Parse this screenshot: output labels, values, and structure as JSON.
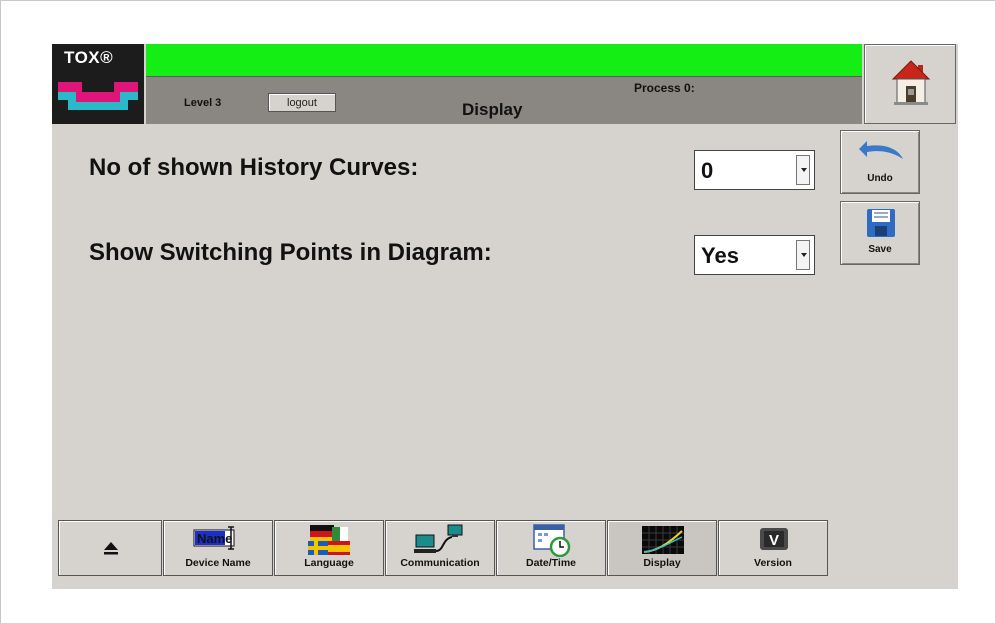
{
  "logo": {
    "brand": "TOX®",
    "text": "TOX"
  },
  "header": {
    "level": "Level 3",
    "logout_label": "logout",
    "process": "Process 0:",
    "title": "Display",
    "status_color": "#15ee15"
  },
  "side_buttons": {
    "home": {
      "icon": "home-icon"
    },
    "undo": {
      "label": "Undo",
      "icon": "undo-arrow-icon"
    },
    "save": {
      "label": "Save",
      "icon": "floppy-disk-icon"
    }
  },
  "settings": [
    {
      "label": "No of shown History Curves:",
      "value": "0"
    },
    {
      "label": "Show Switching Points in Diagram:",
      "value": "Yes"
    }
  ],
  "tabs": [
    {
      "label": "",
      "icon": "eject-triangle-icon"
    },
    {
      "label": "Device Name",
      "icon": "name-field-icon",
      "icon_text": "Name"
    },
    {
      "label": "Language",
      "icon": "flags-icon"
    },
    {
      "label": "Communication",
      "icon": "network-computers-icon"
    },
    {
      "label": "Date/Time",
      "icon": "calendar-clock-icon"
    },
    {
      "label": "Display",
      "icon": "diagram-display-icon",
      "active": true
    },
    {
      "label": "Version",
      "icon": "version-v-icon",
      "icon_text": "V"
    }
  ]
}
